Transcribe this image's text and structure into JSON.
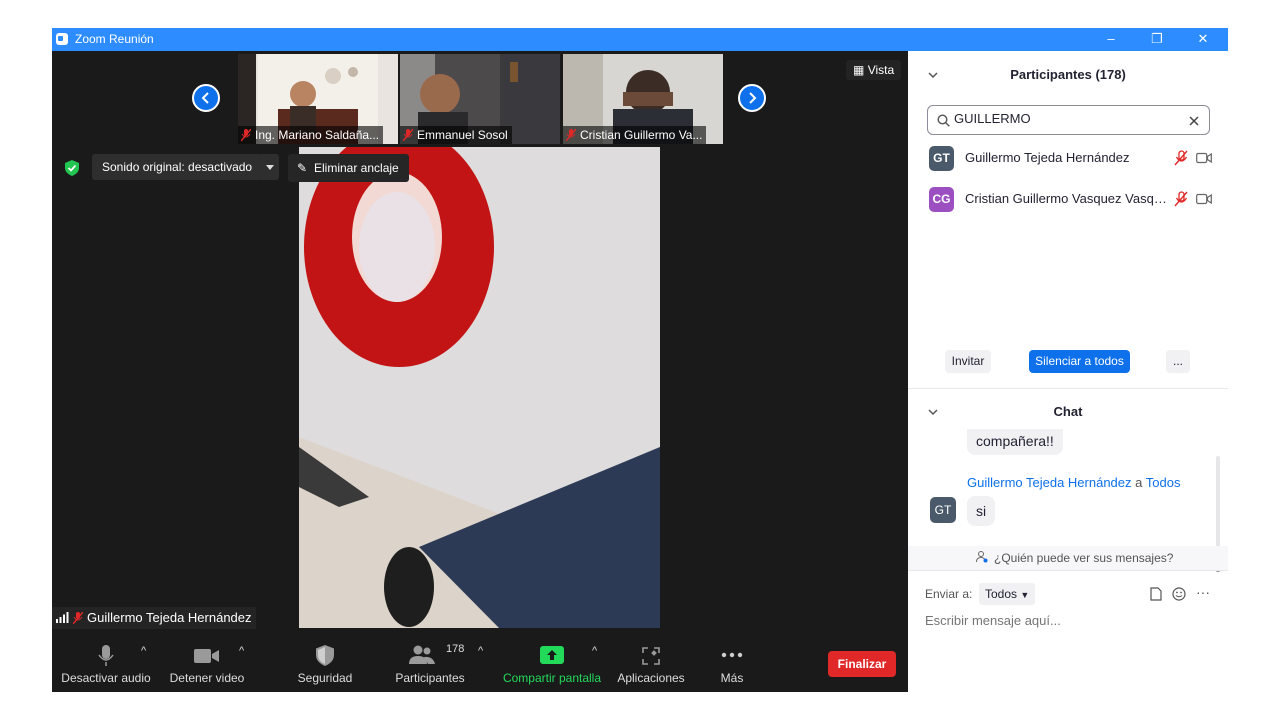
{
  "window": {
    "title": "Zoom Reunión",
    "controls": {
      "minimize": "–",
      "restore": "❐",
      "close": "✕"
    }
  },
  "meeting": {
    "thumbnails": [
      {
        "name": "Ing. Mariano Saldaña..."
      },
      {
        "name": "Emmanuel Sosol"
      },
      {
        "name": "Cristian Guillermo Va..."
      }
    ],
    "view_button": "Vista",
    "sound_original": "Sonido original: desactivado",
    "unpin": "Eliminar anclaje",
    "active_speaker": "Guillermo Tejeda Hernández"
  },
  "toolbar": {
    "mute": "Desactivar audio",
    "video": "Detener video",
    "security": "Seguridad",
    "participants": "Participantes",
    "participants_count": "178",
    "share": "Compartir pantalla",
    "apps": "Aplicaciones",
    "more": "Más",
    "end": "Finalizar"
  },
  "participants_panel": {
    "title": "Participantes (178)",
    "search_value": "GUILLERMO",
    "rows": [
      {
        "initials": "GT",
        "name": "Guillermo Tejeda Hernández",
        "avatar_color": "#4a5a6a"
      },
      {
        "initials": "CG",
        "name": "Cristian Guillermo Vasquez Vasqu...",
        "avatar_color": "#9b4fc0"
      }
    ],
    "invite": "Invitar",
    "mute_all": "Silenciar a todos",
    "more": "..."
  },
  "chat": {
    "title": "Chat",
    "prev_message": "compañera!!",
    "sender": "Guillermo Tejeda Hernández",
    "to_word": "a",
    "recipient": "Todos",
    "sender_initials": "GT",
    "message": "si",
    "who_can_see": "¿Quién puede ver sus mensajes?",
    "send_to_label": "Enviar a:",
    "send_to_value": "Todos",
    "input_placeholder": "Escribir mensaje aquí..."
  },
  "colors": {
    "zoom_blue": "#2d8cff",
    "end_red": "#e02828",
    "share_green": "#23d959",
    "muted_red": "#e02828"
  }
}
